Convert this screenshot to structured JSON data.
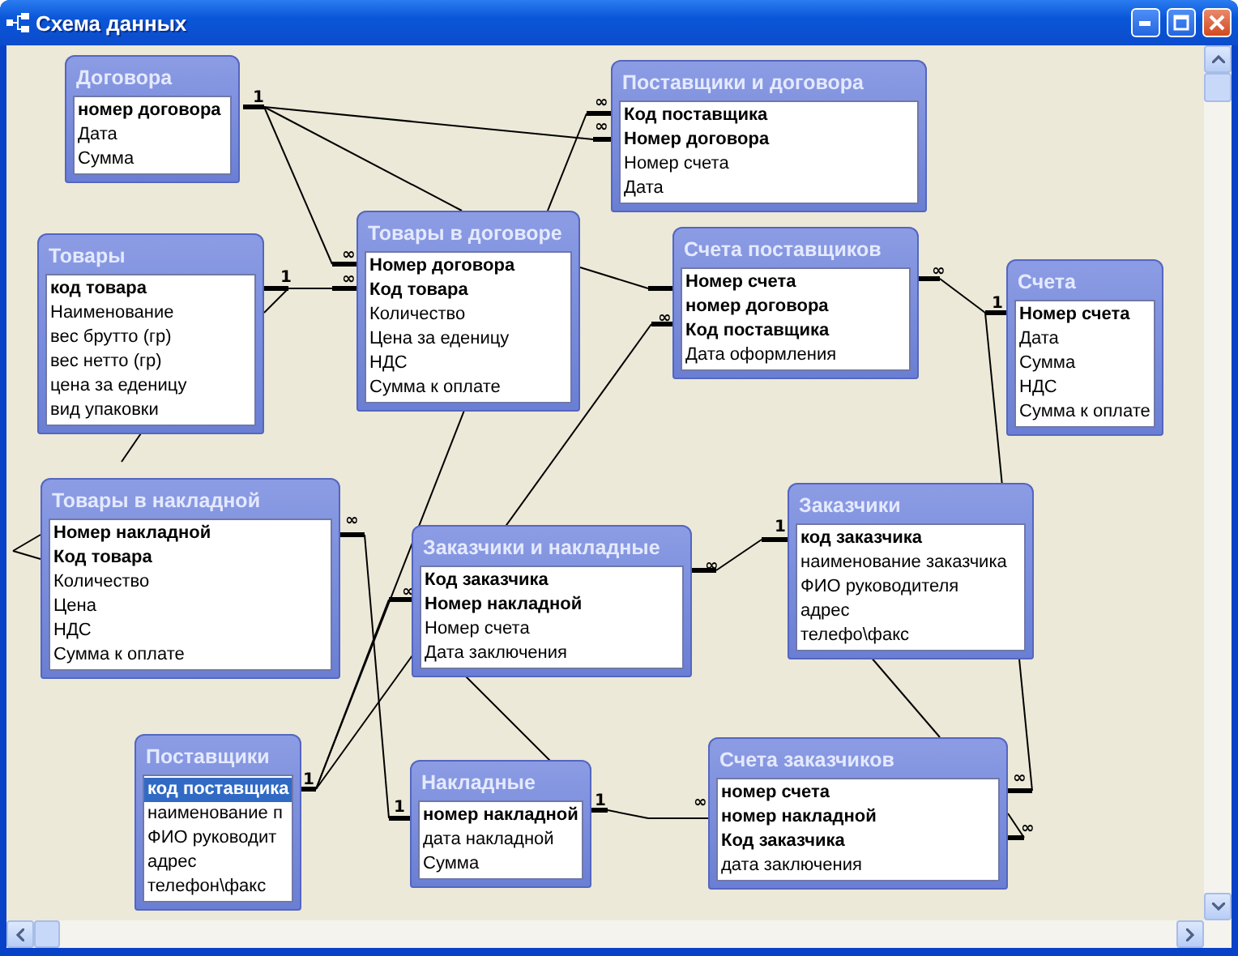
{
  "window": {
    "title": "Схема данных"
  },
  "tables": [
    {
      "title": "Договора",
      "fields": [
        {
          "name": "номер договора",
          "key": true,
          "selected": false
        },
        {
          "name": "Дата",
          "key": false,
          "selected": false
        },
        {
          "name": "Сумма",
          "key": false,
          "selected": false
        }
      ]
    },
    {
      "title": "Поставщики и договора",
      "fields": [
        {
          "name": "Код поставщика",
          "key": true,
          "selected": false
        },
        {
          "name": "Номер договора",
          "key": true,
          "selected": false
        },
        {
          "name": "Номер счета",
          "key": false,
          "selected": false
        },
        {
          "name": "Дата",
          "key": false,
          "selected": false
        }
      ]
    },
    {
      "title": "Товары",
      "fields": [
        {
          "name": "код товара",
          "key": true,
          "selected": false
        },
        {
          "name": "Наименование",
          "key": false,
          "selected": false
        },
        {
          "name": "вес брутто (гр)",
          "key": false,
          "selected": false
        },
        {
          "name": "вес нетто (гр)",
          "key": false,
          "selected": false
        },
        {
          "name": "цена за еденицу",
          "key": false,
          "selected": false
        },
        {
          "name": "вид упаковки",
          "key": false,
          "selected": false
        }
      ]
    },
    {
      "title": "Товары в договоре",
      "fields": [
        {
          "name": "Номер договора",
          "key": true,
          "selected": false
        },
        {
          "name": "Код товара",
          "key": true,
          "selected": false
        },
        {
          "name": "Количество",
          "key": false,
          "selected": false
        },
        {
          "name": "Цена за еденицу",
          "key": false,
          "selected": false
        },
        {
          "name": "НДС",
          "key": false,
          "selected": false
        },
        {
          "name": "Сумма к оплате",
          "key": false,
          "selected": false
        }
      ]
    },
    {
      "title": "Счета поставщиков",
      "fields": [
        {
          "name": "Номер счета",
          "key": true,
          "selected": false
        },
        {
          "name": "номер договора",
          "key": true,
          "selected": false
        },
        {
          "name": "Код поставщика",
          "key": true,
          "selected": false
        },
        {
          "name": "Дата оформления",
          "key": false,
          "selected": false
        }
      ]
    },
    {
      "title": "Счета",
      "fields": [
        {
          "name": "Номер счета",
          "key": true,
          "selected": false
        },
        {
          "name": "Дата",
          "key": false,
          "selected": false
        },
        {
          "name": "Сумма",
          "key": false,
          "selected": false
        },
        {
          "name": "НДС",
          "key": false,
          "selected": false
        },
        {
          "name": "Сумма к оплате",
          "key": false,
          "selected": false
        }
      ]
    },
    {
      "title": "Товары в накладной",
      "fields": [
        {
          "name": "Номер накладной",
          "key": true,
          "selected": false
        },
        {
          "name": "Код товара",
          "key": true,
          "selected": false
        },
        {
          "name": "Количество",
          "key": false,
          "selected": false
        },
        {
          "name": "Цена",
          "key": false,
          "selected": false
        },
        {
          "name": "НДС",
          "key": false,
          "selected": false
        },
        {
          "name": "Сумма к оплате",
          "key": false,
          "selected": false
        }
      ]
    },
    {
      "title": "Заказчики и накладные",
      "fields": [
        {
          "name": "Код заказчика",
          "key": true,
          "selected": false
        },
        {
          "name": "Номер накладной",
          "key": true,
          "selected": false
        },
        {
          "name": "Номер счета",
          "key": false,
          "selected": false
        },
        {
          "name": "Дата заключения",
          "key": false,
          "selected": false
        }
      ]
    },
    {
      "title": "Заказчики",
      "fields": [
        {
          "name": "код заказчика",
          "key": true,
          "selected": false
        },
        {
          "name": "наименование заказчика",
          "key": false,
          "selected": false
        },
        {
          "name": "ФИО руководителя",
          "key": false,
          "selected": false
        },
        {
          "name": "адрес",
          "key": false,
          "selected": false
        },
        {
          "name": "телефо\\факс",
          "key": false,
          "selected": false
        }
      ]
    },
    {
      "title": "Поставщики",
      "fields": [
        {
          "name": "код поставщика",
          "key": true,
          "selected": true
        },
        {
          "name": "наименование п",
          "key": false,
          "selected": false
        },
        {
          "name": "ФИО руководит",
          "key": false,
          "selected": false
        },
        {
          "name": "адрес",
          "key": false,
          "selected": false
        },
        {
          "name": "телефон\\факс",
          "key": false,
          "selected": false
        }
      ]
    },
    {
      "title": "Накладные",
      "fields": [
        {
          "name": "номер накладной",
          "key": true,
          "selected": false
        },
        {
          "name": "дата накладной",
          "key": false,
          "selected": false
        },
        {
          "name": "Сумма",
          "key": false,
          "selected": false
        }
      ]
    },
    {
      "title": "Счета заказчиков",
      "fields": [
        {
          "name": "номер счета",
          "key": true,
          "selected": false
        },
        {
          "name": "номер накладной",
          "key": true,
          "selected": false
        },
        {
          "name": "Код заказчика",
          "key": true,
          "selected": false
        },
        {
          "name": "дата заключения",
          "key": false,
          "selected": false
        }
      ]
    }
  ],
  "cardinality_labels": [
    "1",
    "∞",
    "∞",
    "∞",
    "∞",
    "1",
    "∞",
    "∞",
    "1",
    "∞",
    "∞",
    "∞",
    "1",
    "1",
    "1",
    "1",
    "∞",
    "∞",
    "∞"
  ]
}
